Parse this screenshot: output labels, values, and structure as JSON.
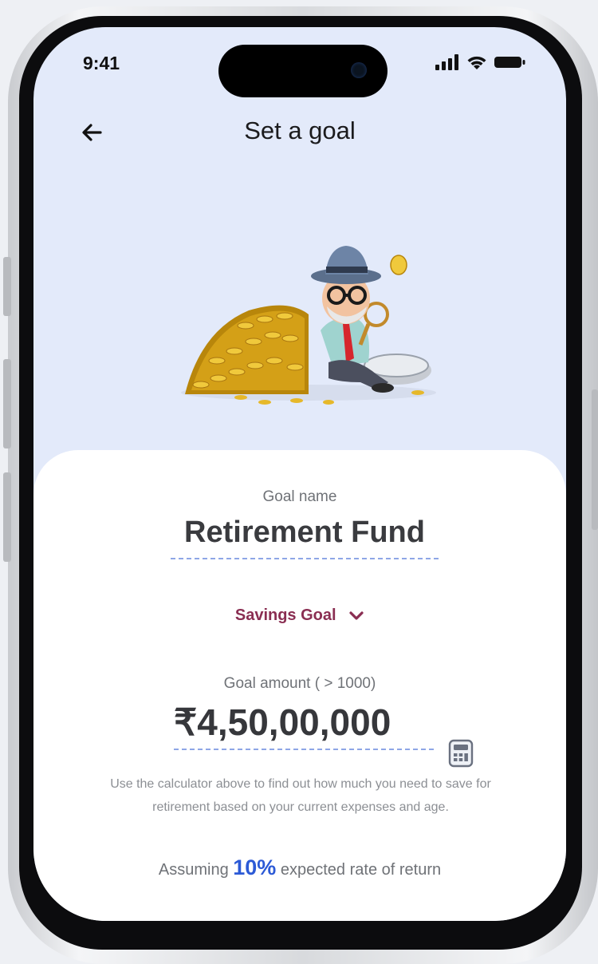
{
  "status_bar": {
    "time": "9:41"
  },
  "nav": {
    "title": "Set a goal",
    "back_icon": "arrow-left-icon"
  },
  "illustration": {
    "description_icon": "retired-man-with-coins-illustration"
  },
  "goal": {
    "name_label": "Goal name",
    "name_value": "Retirement Fund",
    "type_value": "Savings Goal",
    "amount_label": "Goal amount ( > 1000)",
    "amount_value": "₹4,50,00,000",
    "helper_text": "Use the calculator above to find out how much you need to save for retirement based on your current expenses and age.",
    "assumption_prefix": "Assuming",
    "assumption_rate": "10%",
    "assumption_suffix": "expected rate of return"
  },
  "colors": {
    "screen_bg": "#e3eafa",
    "accent_blue": "#2c5ad6",
    "goal_type": "#8a2e52",
    "underline": "#8ea6e6"
  }
}
